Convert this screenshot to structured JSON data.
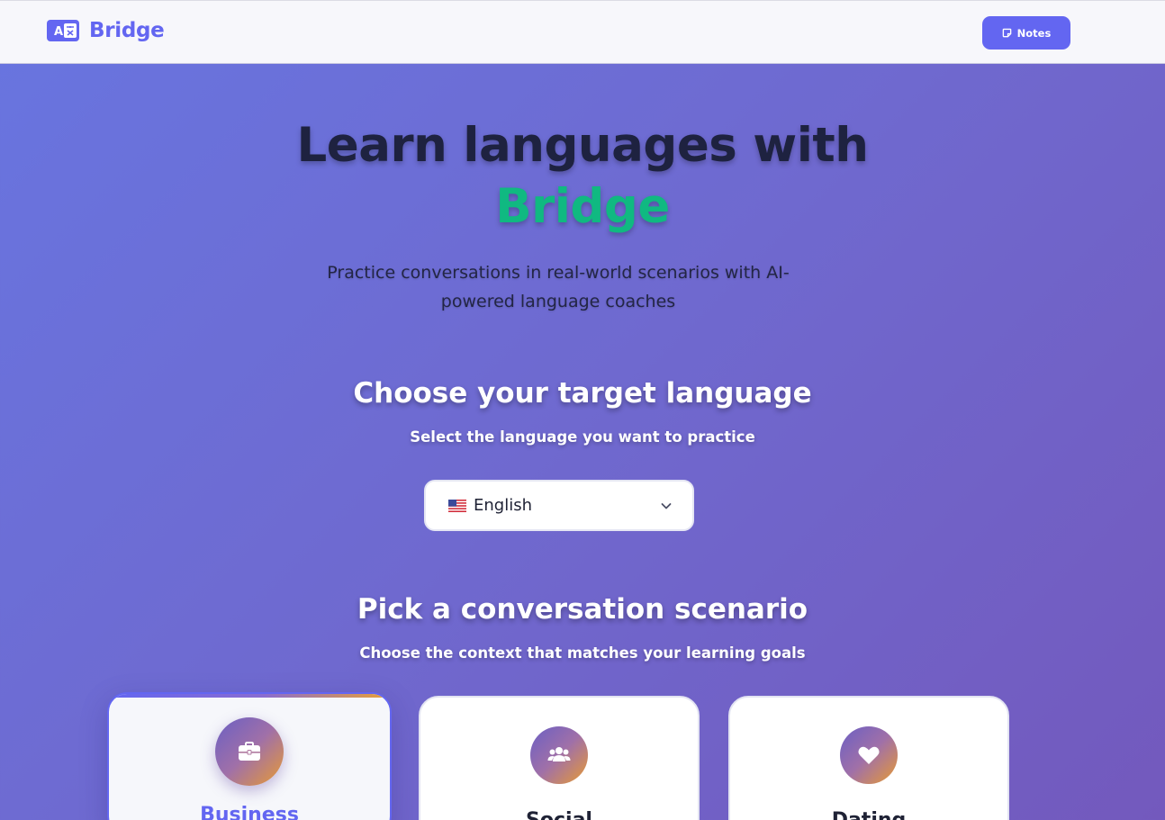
{
  "header": {
    "brand": "Bridge",
    "notes_label": "Notes"
  },
  "hero": {
    "title_line1": "Learn languages with",
    "title_accent": "Bridge",
    "subtitle": "Practice conversations in real-world scenarios with AI-powered language coaches"
  },
  "language_section": {
    "title": "Choose your target language",
    "subtitle": "Select the language you want to practice",
    "selected_language": "English",
    "selected_flag": "us-flag"
  },
  "scenario_section": {
    "title": "Pick a conversation scenario",
    "subtitle": "Choose the context that matches your learning goals",
    "cards": [
      {
        "label": "Business",
        "icon": "briefcase-icon",
        "selected": true
      },
      {
        "label": "Social",
        "icon": "users-icon",
        "selected": false
      },
      {
        "label": "Dating",
        "icon": "heart-icon",
        "selected": false
      }
    ]
  },
  "colors": {
    "accent": "#6366f1",
    "brand_green": "#10b981",
    "background_start": "#6875e0",
    "background_end": "#7359bd"
  }
}
